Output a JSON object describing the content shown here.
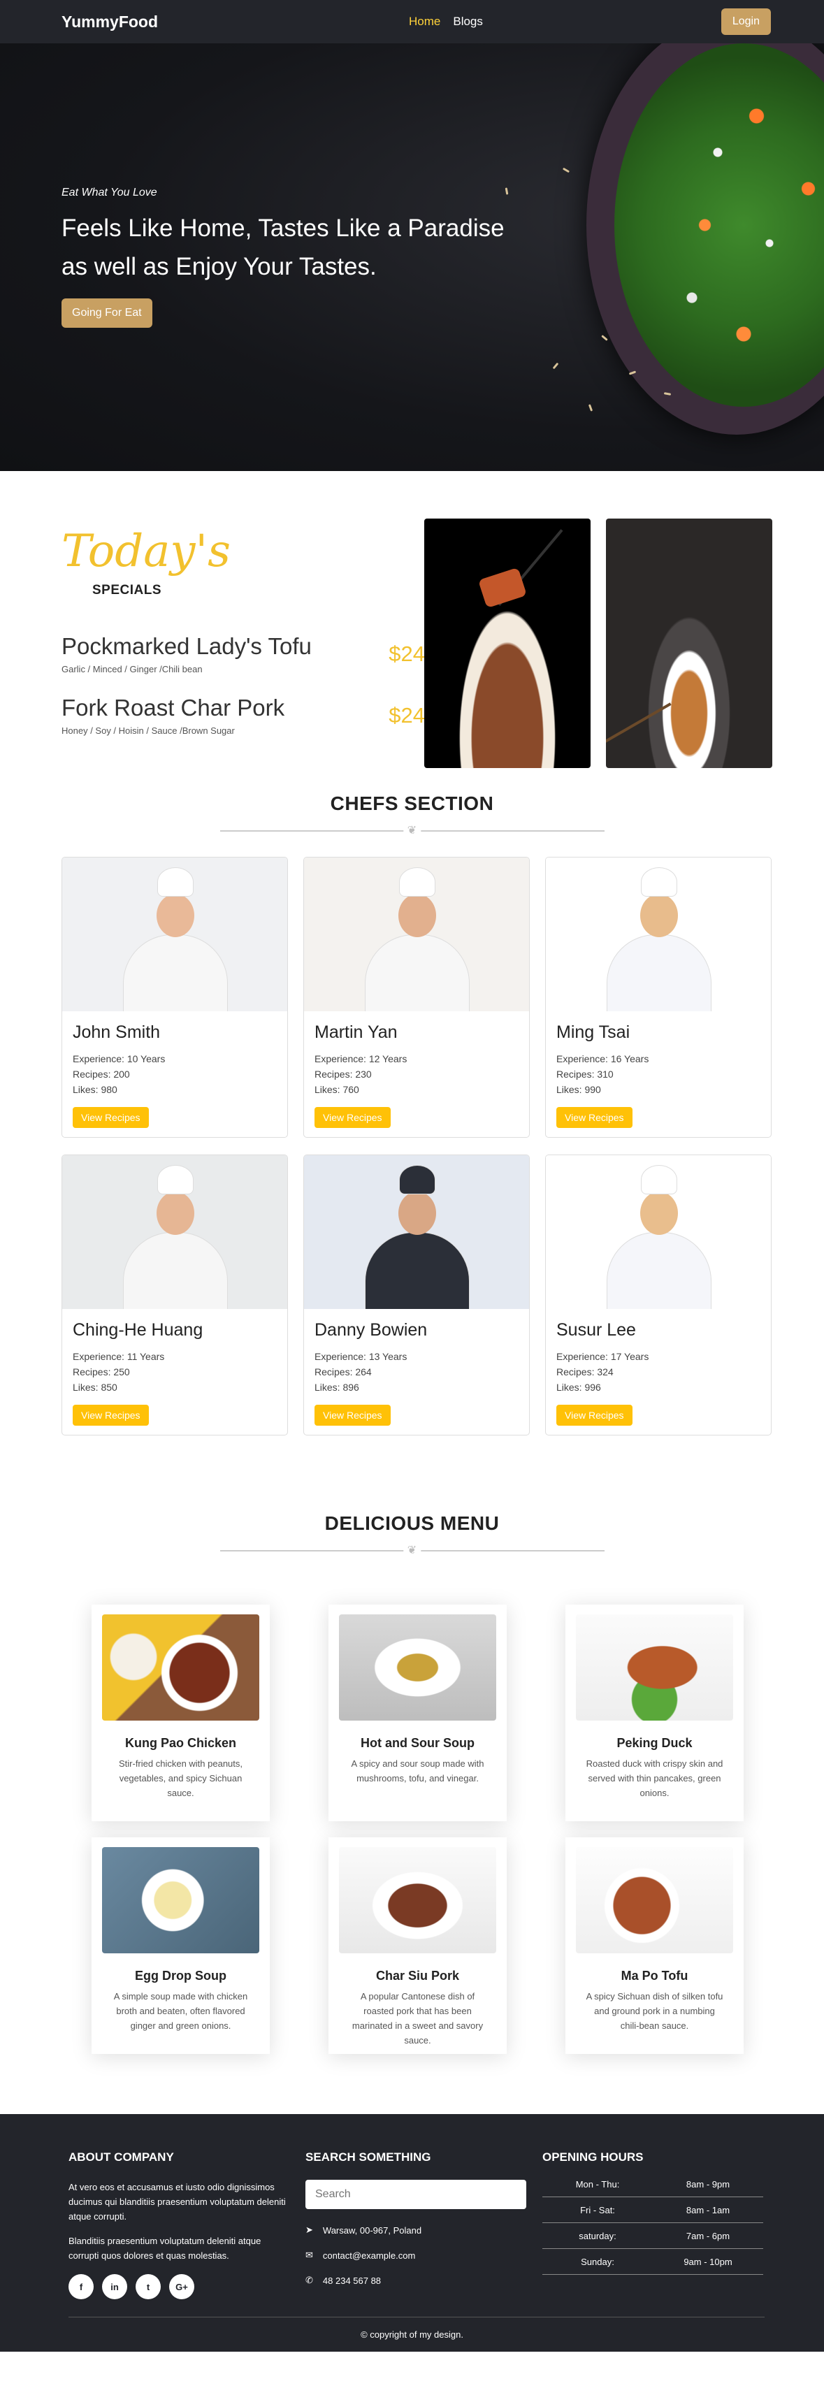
{
  "nav": {
    "brand": "YummyFood",
    "links": [
      "Home",
      "Blogs"
    ],
    "login": "Login"
  },
  "hero": {
    "tagline": "Eat What You Love",
    "title": "Feels Like Home, Tastes Like a Paradise as well as Enjoy Your Tastes.",
    "button": "Going For Eat"
  },
  "specials": {
    "heading": "Today's",
    "subheading": "SPECIALS",
    "dishes": [
      {
        "name": "Pockmarked Lady's Tofu",
        "ingredients": "Garlic / Minced / Ginger /Chili bean",
        "price": "$24"
      },
      {
        "name": "Fork Roast Char Pork",
        "ingredients": "Honey / Soy / Hoisin / Sauce /Brown Sugar",
        "price": "$24"
      }
    ]
  },
  "chefs": {
    "title": "CHEFS SECTION",
    "button_label": "View Recipes",
    "items": [
      {
        "name": "John Smith",
        "experience": "Experience: 10 Years",
        "recipes": "Recipes: 200",
        "likes": "Likes: 980"
      },
      {
        "name": "Martin Yan",
        "experience": "Experience: 12 Years",
        "recipes": "Recipes: 230",
        "likes": "Likes: 760"
      },
      {
        "name": "Ming Tsai",
        "experience": "Experience: 16 Years",
        "recipes": "Recipes: 310",
        "likes": "Likes: 990"
      },
      {
        "name": "Ching-He Huang",
        "experience": "Experience: 11 Years",
        "recipes": "Recipes: 250",
        "likes": "Likes: 850"
      },
      {
        "name": "Danny Bowien",
        "experience": "Experience: 13 Years",
        "recipes": "Recipes: 264",
        "likes": "Likes: 896"
      },
      {
        "name": "Susur Lee",
        "experience": "Experience: 17 Years",
        "recipes": "Recipes: 324",
        "likes": "Likes: 996"
      }
    ]
  },
  "menu": {
    "title": "DELICIOUS MENU",
    "items": [
      {
        "name": "Kung Pao Chicken",
        "desc": "Stir-fried chicken with peanuts, vegetables, and spicy Sichuan sauce."
      },
      {
        "name": "Hot and Sour Soup",
        "desc": "A spicy and sour soup made with mushrooms, tofu, and vinegar."
      },
      {
        "name": "Peking Duck",
        "desc": "Roasted duck with crispy skin and served with thin pancakes, green onions."
      },
      {
        "name": "Egg Drop Soup",
        "desc": "A simple soup made with chicken broth and beaten, often flavored ginger and green onions."
      },
      {
        "name": "Char Siu Pork",
        "desc": "A popular Cantonese dish of roasted pork that has been marinated in a sweet and savory sauce."
      },
      {
        "name": "Ma Po Tofu",
        "desc": "A spicy Sichuan dish of silken tofu and ground pork in a numbing chili-bean sauce."
      }
    ]
  },
  "footer": {
    "about_title": "ABOUT COMPANY",
    "about_p1": "At vero eos et accusamus et iusto odio dignissimos ducimus qui blanditiis praesentium voluptatum deleniti atque corrupti.",
    "about_p2": "Blanditiis praesentium voluptatum deleniti atque corrupti quos dolores et quas molestias.",
    "social_icons": [
      "facebook-icon",
      "linkedin-icon",
      "twitter-icon",
      "google-plus-icon"
    ],
    "search_title": "SEARCH SOMETHING",
    "search_placeholder": "Search",
    "address": "Warsaw, 00-967, Poland",
    "email": "contact@example.com",
    "phone": "48 234 567 88",
    "hours_title": "OPENING HOURS",
    "hours": [
      {
        "day": "Mon - Thu:",
        "time": "8am - 9pm"
      },
      {
        "day": "Fri - Sat:",
        "time": "8am - 1am"
      },
      {
        "day": "saturday:",
        "time": "7am - 6pm"
      },
      {
        "day": "Sunday:",
        "time": "9am - 10pm"
      }
    ],
    "copyright": "© copyright of my design."
  }
}
